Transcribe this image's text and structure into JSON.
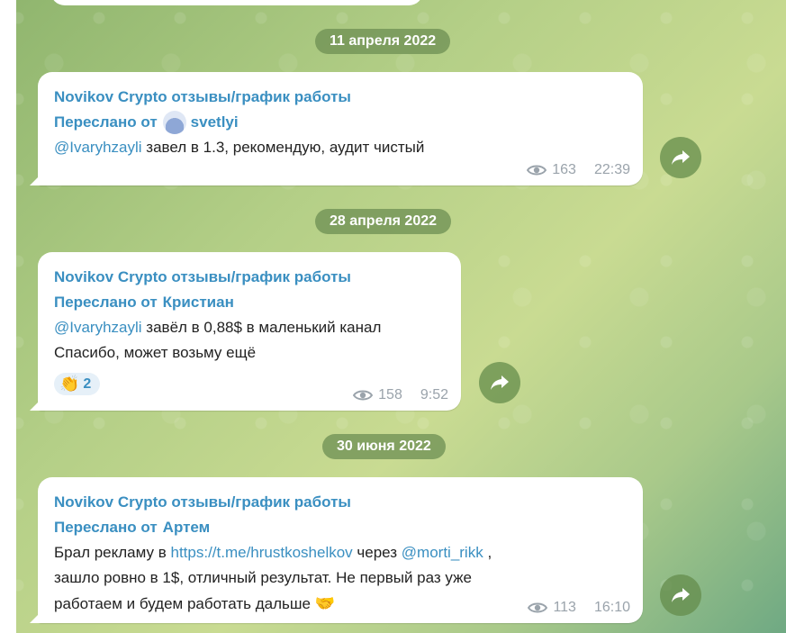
{
  "messages": [
    {
      "date": "11 апреля 2022",
      "channel": "Novikov Crypto отзывы/график работы",
      "forwarded_prefix": "Переслано от",
      "forwarded_name": "svetlyi",
      "mention": "@Ivaryhzayli",
      "text_line1": " завел в 1.3, рекомендую, аудит чистый",
      "views": "163",
      "time": "22:39"
    },
    {
      "date": "28 апреля 2022",
      "channel": "Novikov Crypto отзывы/график работы",
      "forwarded_prefix": "Переслано от",
      "forwarded_name": "Кристиан",
      "mention": "@Ivaryhzayli",
      "text_line1": " завёл в 0,88$ в маленький канал",
      "text_line2": "Спасибо, может возьму ещё",
      "reaction_emoji": "👏",
      "reaction_count": "2",
      "views": "158",
      "time": "9:52"
    },
    {
      "date": "30 июня 2022",
      "channel": "Novikov Crypto отзывы/график работы",
      "forwarded_prefix": "Переслано от",
      "forwarded_name": "Артем",
      "text_pre": "Брал рекламу в ",
      "link": "https://t.me/hrustkoshelkov",
      "text_mid": " через ",
      "mention": "@morti_rikk",
      "text_after": " ,",
      "text_line2": "зашло ровно в 1$, отличный результат. Не первый раз уже",
      "text_line3": "работаем и будем работать дальше ",
      "end_emoji": "🤝",
      "views": "113",
      "time": "16:10"
    }
  ],
  "colors": {
    "accent": "#3a8fc1",
    "date_pill": "#709154",
    "meta": "#9aa3ab"
  },
  "icons": [
    "eye-icon",
    "share-icon",
    "avatar"
  ]
}
